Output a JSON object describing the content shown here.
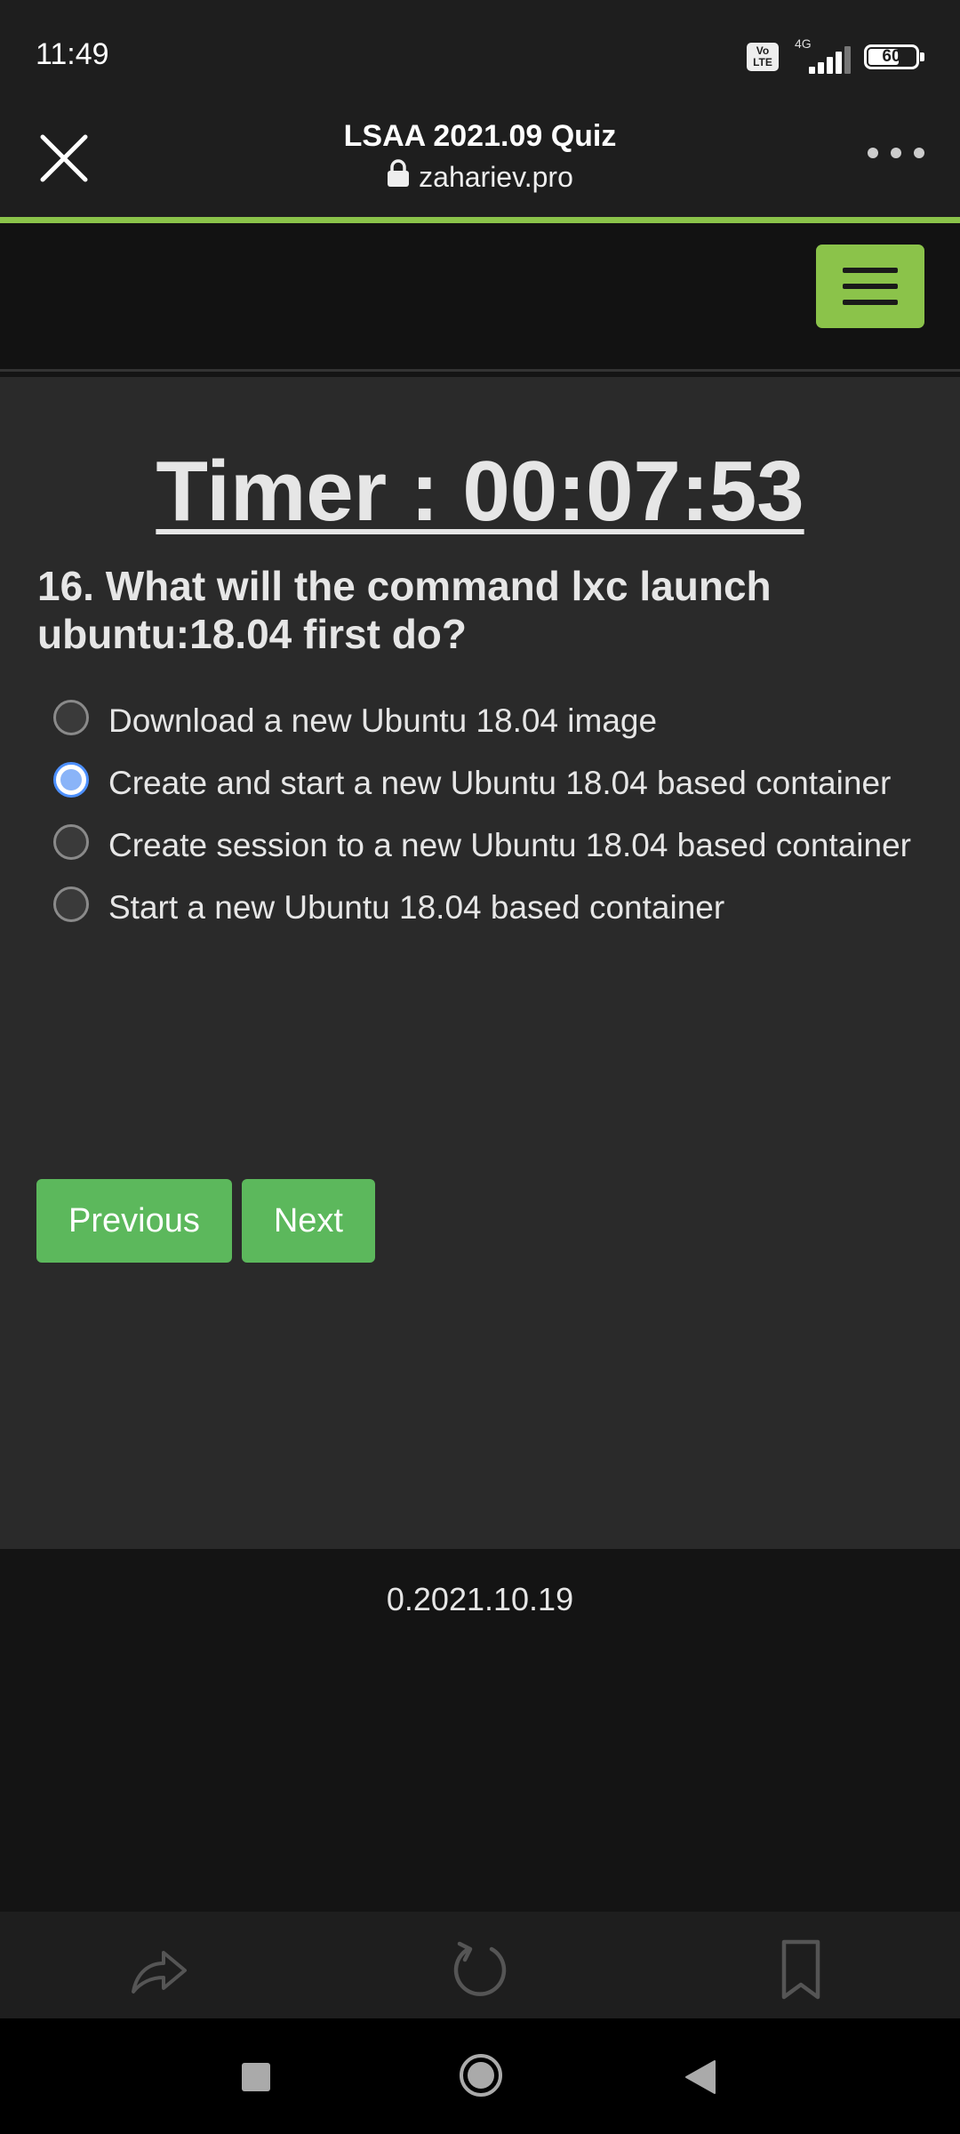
{
  "status_bar": {
    "time": "11:49",
    "volte_line1": "Vo",
    "volte_line2": "LTE",
    "network": "4G",
    "battery": "60"
  },
  "browser": {
    "title": "LSAA 2021.09 Quiz",
    "url": "zahariev.pro"
  },
  "quiz": {
    "timer": "Timer : 00:07:53",
    "question_prefix": "16. What will the command ",
    "question_command": "lxc launch ubuntu:18.04",
    "question_suffix": " first do?",
    "options": [
      {
        "label": "Download a new Ubuntu 18.04 image",
        "selected": false
      },
      {
        "label": "Create and start a new Ubuntu 18.04 based container",
        "selected": true
      },
      {
        "label": "Create session to a new Ubuntu 18.04 based container",
        "selected": false
      },
      {
        "label": "Start a new Ubuntu 18.04 based container",
        "selected": false
      }
    ],
    "previous_label": "Previous",
    "next_label": "Next"
  },
  "footer": {
    "version": "0.2021.10.19"
  },
  "colors": {
    "accent": "#8bc34a",
    "button": "#5cb85c",
    "background": "#2a2a2a",
    "radio_selected": "#8ab4f8"
  },
  "icons": {
    "browser_bottom": [
      "share-icon",
      "reload-icon",
      "bookmark-icon"
    ],
    "system_nav": [
      "recents-icon",
      "home-icon",
      "back-icon"
    ]
  }
}
